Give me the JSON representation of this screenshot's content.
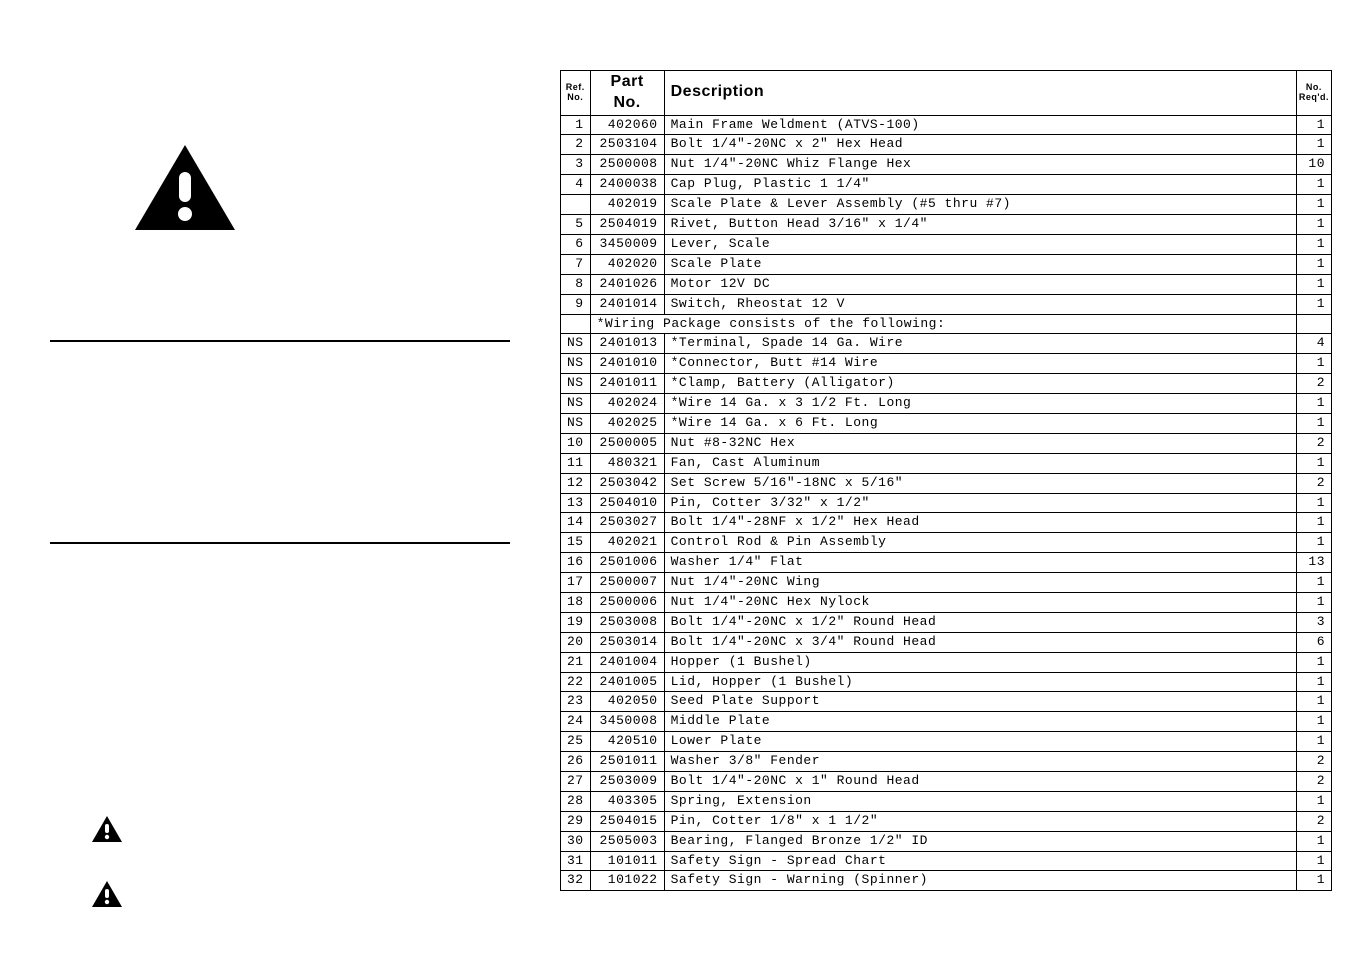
{
  "headers": {
    "ref": "Ref. No.",
    "part": "Part No.",
    "desc": "Description",
    "qty": "No. Req'd."
  },
  "rows": [
    {
      "ref": "1",
      "part": "402060",
      "desc": "Main Frame Weldment (ATVS-100)",
      "qty": "1"
    },
    {
      "ref": "2",
      "part": "2503104",
      "desc": "Bolt 1/4\"-20NC x 2\" Hex Head",
      "qty": "1"
    },
    {
      "ref": "3",
      "part": "2500008",
      "desc": "Nut 1/4\"-20NC Whiz Flange Hex",
      "qty": "10"
    },
    {
      "ref": "4",
      "part": "2400038",
      "desc": "Cap Plug, Plastic 1 1/4\"",
      "qty": "1"
    },
    {
      "ref": "",
      "part": "402019",
      "desc": "Scale Plate & Lever Assembly (#5 thru #7)",
      "qty": "1"
    },
    {
      "ref": "5",
      "part": "2504019",
      "desc": "Rivet, Button Head 3/16\" x 1/4\"",
      "qty": "1"
    },
    {
      "ref": "6",
      "part": "3450009",
      "desc": "Lever, Scale",
      "qty": "1"
    },
    {
      "ref": "7",
      "part": "402020",
      "desc": "Scale Plate",
      "qty": "1"
    },
    {
      "ref": "8",
      "part": "2401026",
      "desc": "Motor 12V DC",
      "qty": "1"
    },
    {
      "ref": "9",
      "part": "2401014",
      "desc": "Switch, Rheostat 12 V",
      "qty": "1"
    },
    {
      "ref": "",
      "part": "",
      "desc": "*Wiring Package consists of the following:",
      "qty": ""
    },
    {
      "ref": "NS",
      "part": "2401013",
      "desc": "*Terminal, Spade 14 Ga. Wire",
      "qty": "4"
    },
    {
      "ref": "NS",
      "part": "2401010",
      "desc": "*Connector, Butt #14 Wire",
      "qty": "1"
    },
    {
      "ref": "NS",
      "part": "2401011",
      "desc": "*Clamp, Battery (Alligator)",
      "qty": "2"
    },
    {
      "ref": "NS",
      "part": "402024",
      "desc": "*Wire 14 Ga. x 3 1/2 Ft. Long",
      "qty": "1"
    },
    {
      "ref": "NS",
      "part": "402025",
      "desc": "*Wire 14 Ga. x 6 Ft. Long",
      "qty": "1"
    },
    {
      "ref": "10",
      "part": "2500005",
      "desc": "Nut #8-32NC Hex",
      "qty": "2"
    },
    {
      "ref": "11",
      "part": "480321",
      "desc": "Fan, Cast Aluminum",
      "qty": "1"
    },
    {
      "ref": "12",
      "part": "2503042",
      "desc": "Set Screw 5/16\"-18NC x 5/16\"",
      "qty": "2"
    },
    {
      "ref": "13",
      "part": "2504010",
      "desc": "Pin, Cotter 3/32\" x 1/2\"",
      "qty": "1"
    },
    {
      "ref": "14",
      "part": "2503027",
      "desc": "Bolt 1/4\"-28NF x 1/2\" Hex Head",
      "qty": "1"
    },
    {
      "ref": "15",
      "part": "402021",
      "desc": "Control Rod & Pin Assembly",
      "qty": "1"
    },
    {
      "ref": "16",
      "part": "2501006",
      "desc": "Washer 1/4\" Flat",
      "qty": "13"
    },
    {
      "ref": "17",
      "part": "2500007",
      "desc": "Nut 1/4\"-20NC Wing",
      "qty": "1"
    },
    {
      "ref": "18",
      "part": "2500006",
      "desc": "Nut 1/4\"-20NC Hex Nylock",
      "qty": "1"
    },
    {
      "ref": "19",
      "part": "2503008",
      "desc": "Bolt 1/4\"-20NC x 1/2\" Round Head",
      "qty": "3"
    },
    {
      "ref": "20",
      "part": "2503014",
      "desc": "Bolt 1/4\"-20NC x 3/4\" Round Head",
      "qty": "6"
    },
    {
      "ref": "21",
      "part": "2401004",
      "desc": "Hopper (1 Bushel)",
      "qty": "1"
    },
    {
      "ref": "22",
      "part": "2401005",
      "desc": "Lid, Hopper (1 Bushel)",
      "qty": "1"
    },
    {
      "ref": "23",
      "part": "402050",
      "desc": "Seed Plate Support",
      "qty": "1"
    },
    {
      "ref": "24",
      "part": "3450008",
      "desc": "Middle Plate",
      "qty": "1"
    },
    {
      "ref": "25",
      "part": "420510",
      "desc": "Lower Plate",
      "qty": "1"
    },
    {
      "ref": "26",
      "part": "2501011",
      "desc": "Washer 3/8\" Fender",
      "qty": "2"
    },
    {
      "ref": "27",
      "part": "2503009",
      "desc": "Bolt 1/4\"-20NC x 1\" Round Head",
      "qty": "2"
    },
    {
      "ref": "28",
      "part": "403305",
      "desc": "Spring, Extension",
      "qty": "1"
    },
    {
      "ref": "29",
      "part": "2504015",
      "desc": "Pin, Cotter 1/8\" x 1 1/2\"",
      "qty": "2"
    },
    {
      "ref": "30",
      "part": "2505003",
      "desc": "Bearing, Flanged Bronze 1/2\" ID",
      "qty": "1"
    },
    {
      "ref": "31",
      "part": "101011",
      "desc": "Safety Sign - Spread Chart",
      "qty": "1"
    },
    {
      "ref": "32",
      "part": "101022",
      "desc": "Safety Sign - Warning (Spinner)",
      "qty": "1"
    }
  ]
}
